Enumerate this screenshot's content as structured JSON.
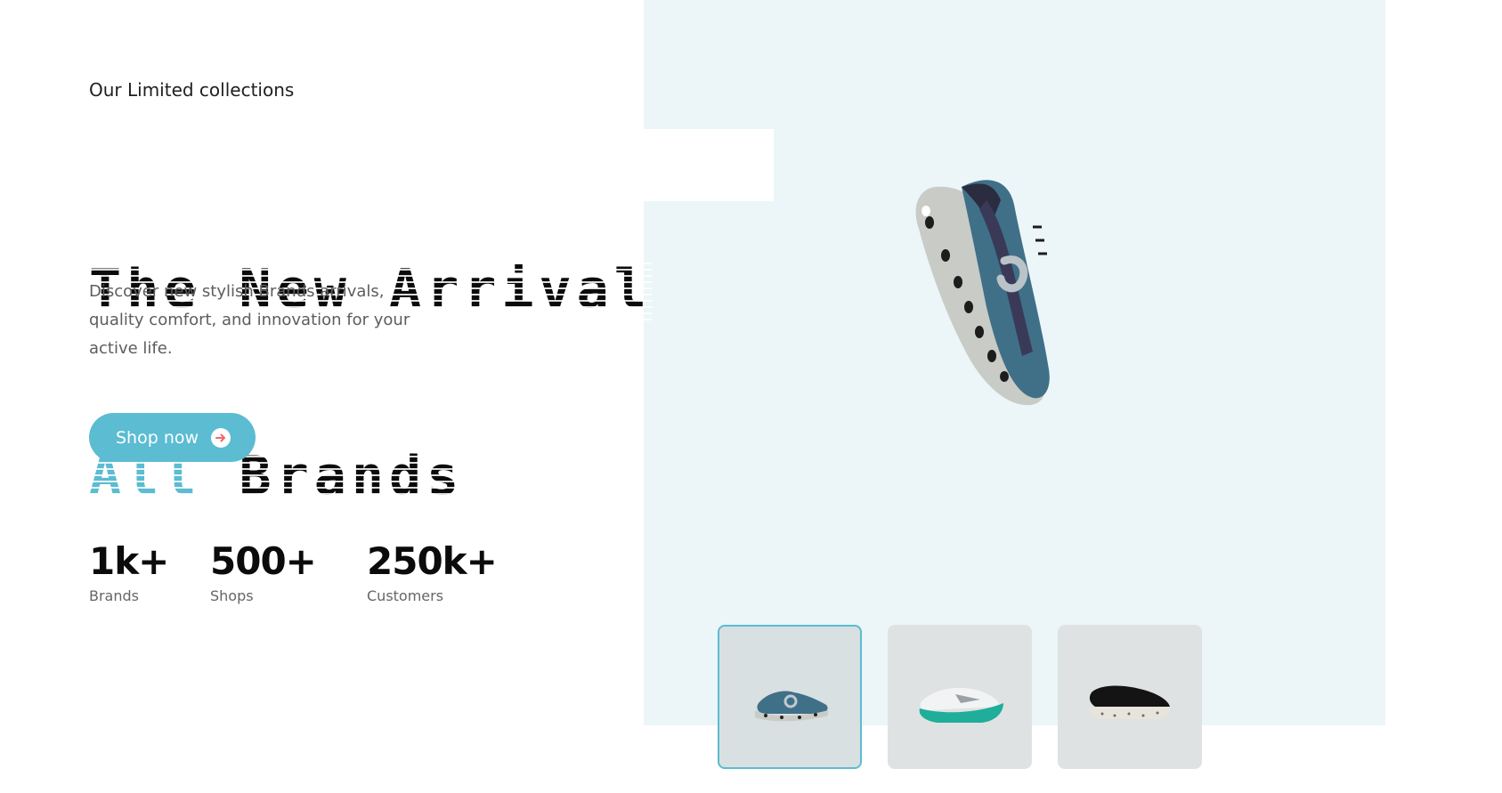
{
  "hero": {
    "eyebrow": "Our Limited collections",
    "headline_line1": "The New Arrival",
    "headline_accent": "All",
    "headline_rest": "Brands",
    "description": "Discover new stylish Brands arrivals, quality comfort, and innovation for your active life.",
    "cta_label": "Shop now"
  },
  "stats": [
    {
      "value": "1k+",
      "label": "Brands"
    },
    {
      "value": "500+",
      "label": "Shops"
    },
    {
      "value": "250k+",
      "label": "Customers"
    }
  ],
  "gallery": {
    "selected_index": 0,
    "thumbnails": [
      {
        "icon": "blue-runner-shoe-icon"
      },
      {
        "icon": "white-teal-shoe-icon"
      },
      {
        "icon": "black-trail-shoe-icon"
      }
    ]
  },
  "colors": {
    "accent": "#5bbcd2",
    "panel": "#ecf6f8",
    "cta_arrow": "#f0686a"
  }
}
